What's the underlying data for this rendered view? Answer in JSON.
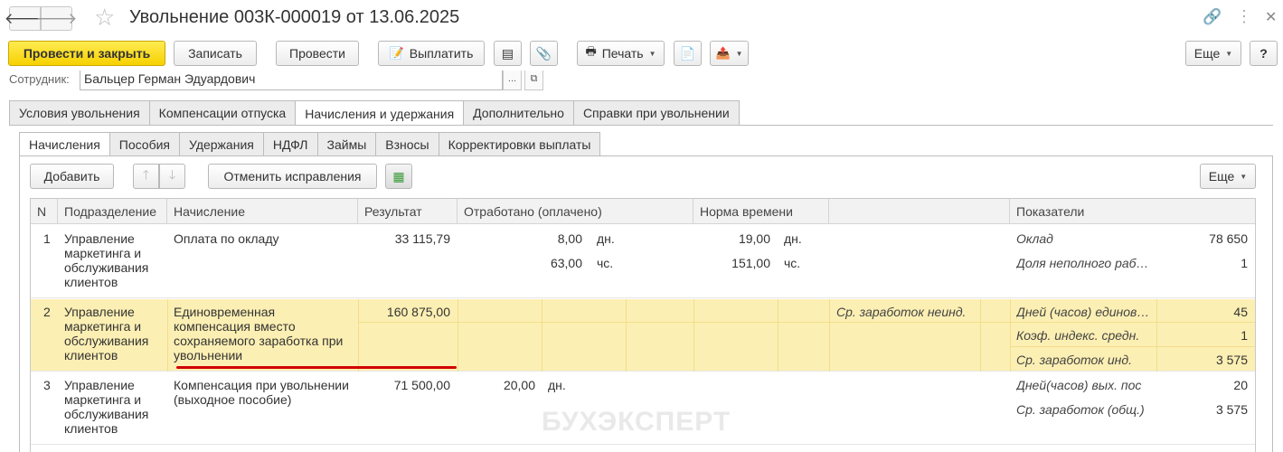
{
  "window": {
    "title": "Увольнение 003К-000019 от 13.06.2025"
  },
  "toolbar": {
    "post_and_close": "Провести и закрыть",
    "save": "Записать",
    "post": "Провести",
    "pay": "Выплатить",
    "print": "Печать",
    "more": "Еще",
    "help": "?"
  },
  "employee": {
    "label": "Сотрудник:",
    "value": "Бальцер Герман Эдуардович",
    "select_btn": "..."
  },
  "tabs": [
    {
      "label": "Условия увольнения"
    },
    {
      "label": "Компенсации отпуска"
    },
    {
      "label": "Начисления и удержания"
    },
    {
      "label": "Дополнительно"
    },
    {
      "label": "Справки при увольнении"
    }
  ],
  "subtabs": [
    {
      "label": "Начисления"
    },
    {
      "label": "Пособия"
    },
    {
      "label": "Удержания"
    },
    {
      "label": "НДФЛ"
    },
    {
      "label": "Займы"
    },
    {
      "label": "Взносы"
    },
    {
      "label": "Корректировки выплаты"
    }
  ],
  "grid_toolbar": {
    "add": "Добавить",
    "cancel_corrections": "Отменить исправления",
    "more": "Еще"
  },
  "columns": [
    "N",
    "Подразделение",
    "Начисление",
    "Результат",
    "Отработано (оплачено)",
    "Норма времени",
    "",
    "Показатели"
  ],
  "watermark": "БУХЭКСПЕРТ",
  "rows": [
    {
      "n": "1",
      "department": "Управление маркетинга и обслуживания клиентов",
      "accrual": "Оплата по окладу",
      "result": "33 115,79",
      "worked_days": "8,00",
      "worked_days_unit": "дн.",
      "worked_hours": "63,00",
      "worked_hours_unit": "чс.",
      "norm_days": "19,00",
      "norm_days_unit": "дн.",
      "norm_hours": "151,00",
      "norm_hours_unit": "чс.",
      "indicators": [
        {
          "name": "Оклад",
          "value": "78 650"
        },
        {
          "name": "Доля неполного рабочего времени",
          "value": "1"
        }
      ]
    },
    {
      "n": "2",
      "department": "Управление маркетинга и обслуживания клиентов",
      "accrual": "Единовременная компенсация вместо сохраняемого заработка при увольнении",
      "result": "160 875,00",
      "extra": "Ср. заработок неинд.",
      "indicators": [
        {
          "name": "Дней (часов) единовременной компенсации",
          "value": "45"
        },
        {
          "name": "Коэф. индекс. средн.",
          "value": "1"
        },
        {
          "name": "Ср. заработок инд.",
          "value": "3 575"
        }
      ]
    },
    {
      "n": "3",
      "department": "Управление маркетинга и обслуживания клиентов",
      "accrual": "Компенсация при увольнении (выходное пособие)",
      "result": "71 500,00",
      "worked_days": "20,00",
      "worked_days_unit": "дн.",
      "indicators": [
        {
          "name": "Дней(часов) вых. пос",
          "value": "20"
        },
        {
          "name": "Ср. заработок (общ.)",
          "value": "3 575"
        }
      ]
    }
  ],
  "colors": {
    "primary_button": "#f6d000",
    "selected_row": "#fcefb3",
    "highlight_underline": "#d20000"
  }
}
